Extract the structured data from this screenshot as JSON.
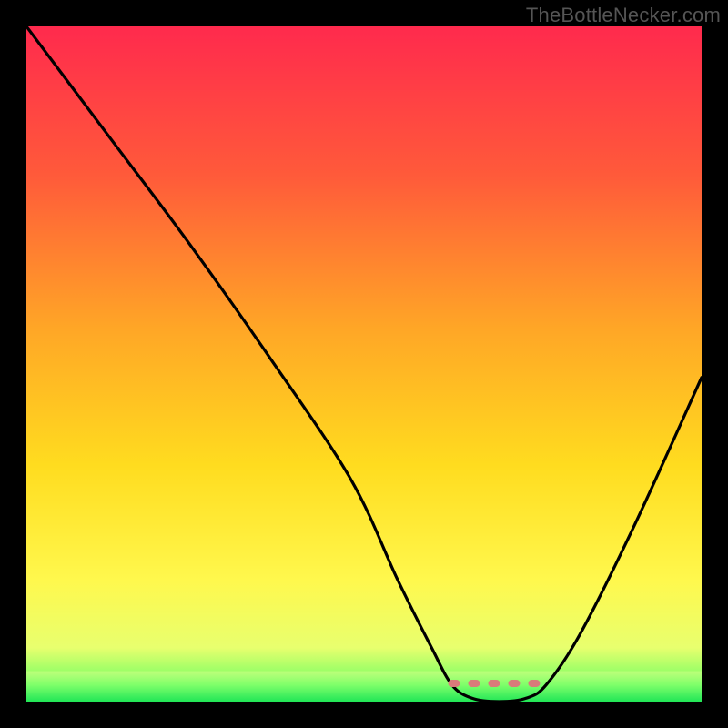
{
  "watermark": "TheBottleNecker.com",
  "chart_data": {
    "type": "line",
    "title": "",
    "xlabel": "",
    "ylabel": "",
    "xlim": [
      0,
      100
    ],
    "ylim": [
      0,
      100
    ],
    "curve": [
      {
        "x": 0,
        "y": 100
      },
      {
        "x": 12,
        "y": 84
      },
      {
        "x": 24,
        "y": 68
      },
      {
        "x": 36,
        "y": 51
      },
      {
        "x": 48,
        "y": 33
      },
      {
        "x": 55,
        "y": 18
      },
      {
        "x": 60,
        "y": 8
      },
      {
        "x": 63,
        "y": 2.5
      },
      {
        "x": 66,
        "y": 0.5
      },
      {
        "x": 70,
        "y": 0
      },
      {
        "x": 74,
        "y": 0.5
      },
      {
        "x": 77,
        "y": 2.5
      },
      {
        "x": 82,
        "y": 10
      },
      {
        "x": 90,
        "y": 26
      },
      {
        "x": 100,
        "y": 48
      }
    ],
    "dashed_segment": [
      {
        "x": 63,
        "y": 2.7
      },
      {
        "x": 77,
        "y": 2.7
      }
    ],
    "green_band_y": [
      0,
      4.5
    ],
    "gradient_stops_top_to_bottom": [
      {
        "pos": 0.0,
        "color": "#ff2a4d"
      },
      {
        "pos": 0.22,
        "color": "#ff5a3a"
      },
      {
        "pos": 0.45,
        "color": "#ffa726"
      },
      {
        "pos": 0.65,
        "color": "#ffdc1f"
      },
      {
        "pos": 0.82,
        "color": "#fff84d"
      },
      {
        "pos": 0.92,
        "color": "#e8ff6e"
      },
      {
        "pos": 1.0,
        "color": "#3bff5e"
      }
    ],
    "dash_color": "#d97a7a",
    "curve_color": "#000000"
  }
}
